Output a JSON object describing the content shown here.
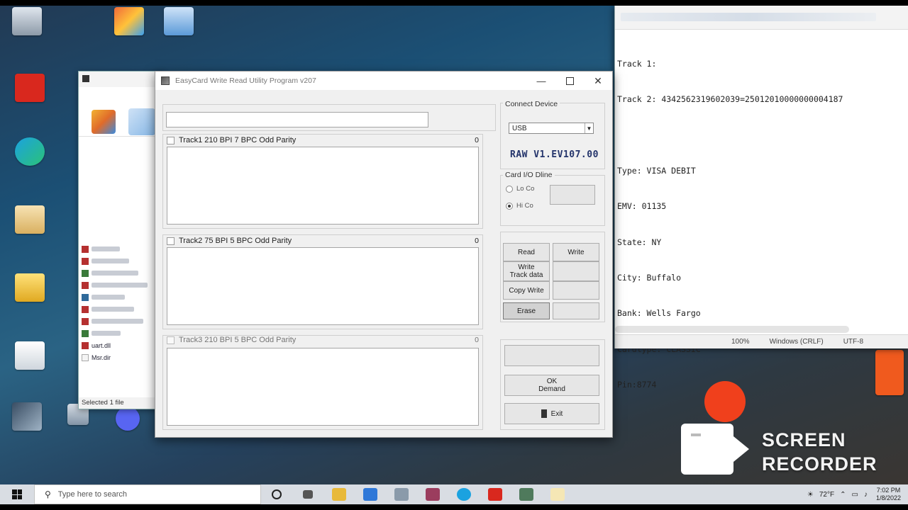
{
  "notepad": {
    "lines": [
      {
        "pre": "Track 1: ",
        "hl": "",
        "text": ""
      },
      {
        "pre": "Track 2: ",
        "hl": "",
        "text": "4342562319602039=25012010000000004187"
      },
      {
        "pre": "",
        "hl": "",
        "text": ""
      },
      {
        "pre": "",
        "hl": "",
        "text": "Type: VISA DEBIT"
      },
      {
        "pre": "",
        "hl": "",
        "text": "EMV: 01135"
      },
      {
        "pre": "",
        "hl": "",
        "text": "State: NY"
      },
      {
        "pre": "",
        "hl": "",
        "text": "City: Buffalo"
      },
      {
        "pre": "",
        "hl": "",
        "text": "Bank: Wells Fargo"
      },
      {
        "pre": "",
        "hl": "",
        "text": "Cardtype: CLASSIC"
      },
      {
        "pre": "",
        "hl": "",
        "text": "Pin:8774"
      }
    ],
    "status": [
      "",
      "100%",
      "Windows (CRLF)",
      "UTF-8"
    ]
  },
  "explorer": {
    "items": [
      "",
      "",
      "",
      "",
      "",
      "",
      "",
      "",
      "",
      "",
      "",
      "",
      "",
      "",
      "",
      "",
      "",
      "",
      "",
      "",
      "",
      "",
      "",
      "",
      "",
      "",
      "",
      "",
      ""
    ],
    "named_items": [
      "uart.dll",
      "Msr.dir"
    ],
    "status": "Selected 1 file"
  },
  "app": {
    "title": "EasyCard Write Read Utility Program v207",
    "tracks": [
      {
        "label": "Track1   210 BPI  7 BPC  Odd Parity",
        "count": "0"
      },
      {
        "label": "Track2   75 BPI  5 BPC  Odd Parity",
        "count": "0"
      },
      {
        "label": "Track3   210 BPI  5 BPC  Odd Parity",
        "count": "0"
      }
    ],
    "connect_legend": "Connect Device",
    "port_value": "USB",
    "device_text": "RAW  V1.EV107.00",
    "coercivity_legend": "Card I/O Dline",
    "radios": [
      {
        "label": "Lo Co",
        "on": false
      },
      {
        "label": "Hi Co",
        "on": true
      }
    ],
    "buttons": {
      "read": "Read",
      "write": "Write",
      "write2": "Write\nTrack data",
      "copy_write": "Copy Write",
      "erase": "Erase",
      "demand": "OK\nDemand",
      "exit": "Exit"
    }
  },
  "recorder": {
    "line1": "SCREEN",
    "line2": "RECORDER"
  },
  "taskbar": {
    "search_placeholder": "Type here to search",
    "temperature": "72°F",
    "time": "7:02 PM",
    "date": "1/8/2022"
  }
}
